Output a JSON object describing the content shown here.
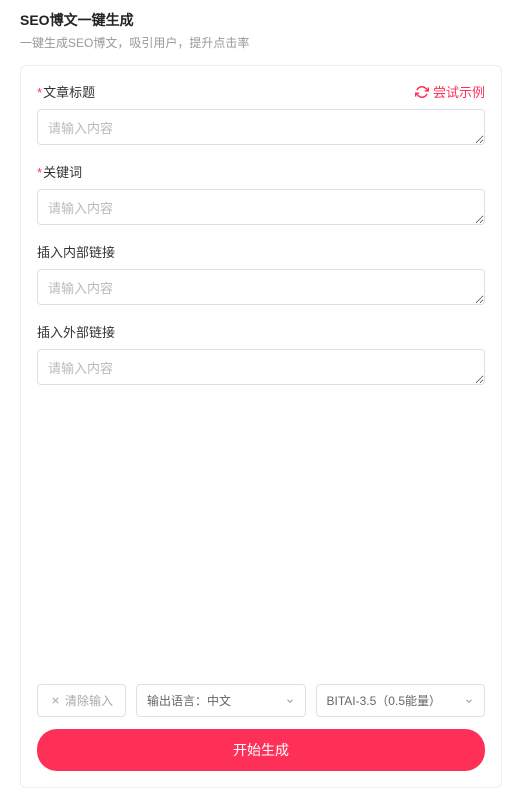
{
  "header": {
    "title": "SEO博文一键生成",
    "subtitle": "一键生成SEO博文，吸引用户，提升点击率"
  },
  "tryExampleLabel": "尝试示例",
  "fields": [
    {
      "label": "文章标题",
      "required": true,
      "placeholder": "请输入内容"
    },
    {
      "label": "关键词",
      "required": true,
      "placeholder": "请输入内容"
    },
    {
      "label": "插入内部链接",
      "required": false,
      "placeholder": "请输入内容"
    },
    {
      "label": "插入外部链接",
      "required": false,
      "placeholder": "请输入内容"
    }
  ],
  "controls": {
    "clearLabel": "清除输入",
    "languageLabel": "输出语言：中文",
    "modelLabel": "BITAI-3.5（0.5能量）",
    "startLabel": "开始生成"
  }
}
